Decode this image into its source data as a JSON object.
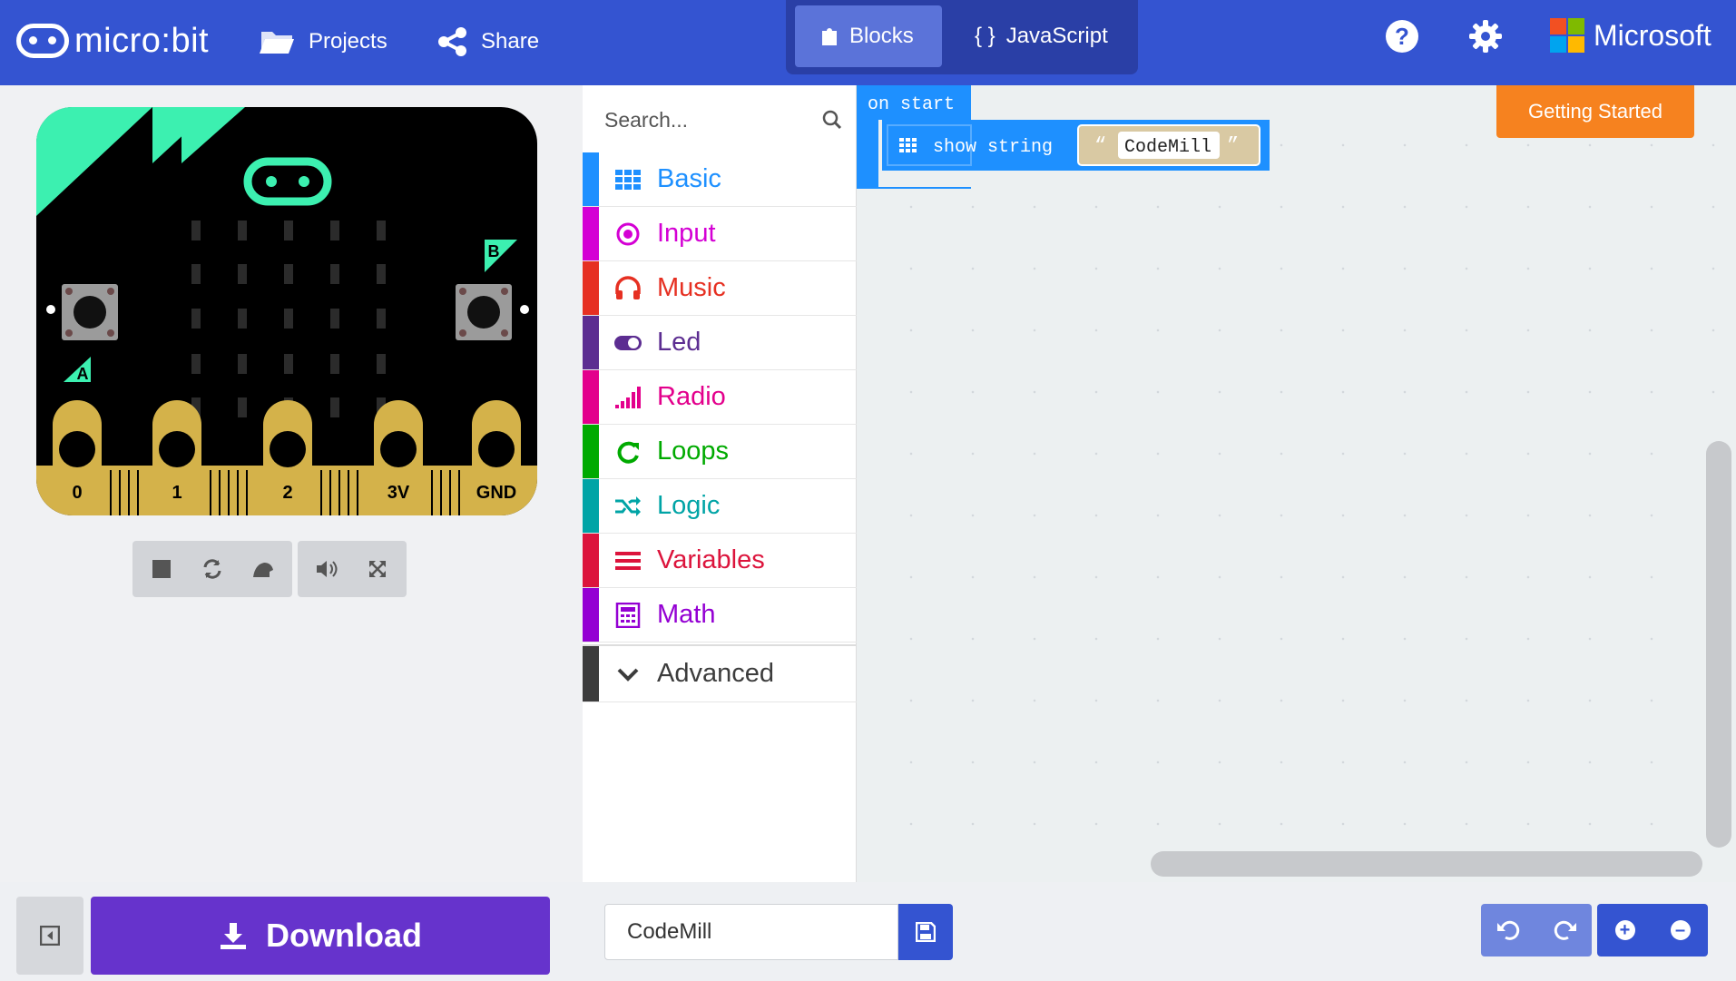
{
  "app": {
    "logo_text": "micro:bit",
    "brand": "Microsoft"
  },
  "nav": {
    "projects": "Projects",
    "share": "Share"
  },
  "modes": {
    "blocks": "Blocks",
    "javascript": "JavaScript",
    "javascript_icon_text": "{ }",
    "active": "Blocks"
  },
  "header_icons": {
    "help": "?",
    "help_icon": "help-icon",
    "settings_icon": "gear-icon"
  },
  "simulator": {
    "pins": [
      "0",
      "1",
      "2",
      "3V",
      "GND"
    ],
    "button_a": "A",
    "button_b": "B",
    "controls": [
      "stop-icon",
      "restart-icon",
      "slow-mo-icon",
      "mute-icon",
      "fullscreen-icon"
    ]
  },
  "toolbox": {
    "search_placeholder": "Search...",
    "categories": [
      {
        "label": "Basic",
        "color": "#1e90ff",
        "icon": "grid-icon"
      },
      {
        "label": "Input",
        "color": "#d400d4",
        "icon": "target-icon"
      },
      {
        "label": "Music",
        "color": "#e63022",
        "icon": "headphones-icon"
      },
      {
        "label": "Led",
        "color": "#5c2d91",
        "icon": "toggle-icon"
      },
      {
        "label": "Radio",
        "color": "#e3008c",
        "icon": "signal-icon"
      },
      {
        "label": "Loops",
        "color": "#00aa00",
        "icon": "loop-icon"
      },
      {
        "label": "Logic",
        "color": "#00a4a6",
        "icon": "shuffle-icon"
      },
      {
        "label": "Variables",
        "color": "#dc143c",
        "icon": "lines-icon"
      },
      {
        "label": "Math",
        "color": "#9400d3",
        "icon": "calculator-icon"
      }
    ],
    "advanced": "Advanced"
  },
  "workspace": {
    "getting_started": "Getting Started",
    "block_event": "on start",
    "block_statement": "show string",
    "block_value": "CodeMill"
  },
  "bottom": {
    "download": "Download",
    "project_name": "CodeMill"
  },
  "colors": {
    "topbar": "#3454d1",
    "download": "#6633cc",
    "getting_started": "#f6821f",
    "basic_block": "#1e90ff"
  }
}
